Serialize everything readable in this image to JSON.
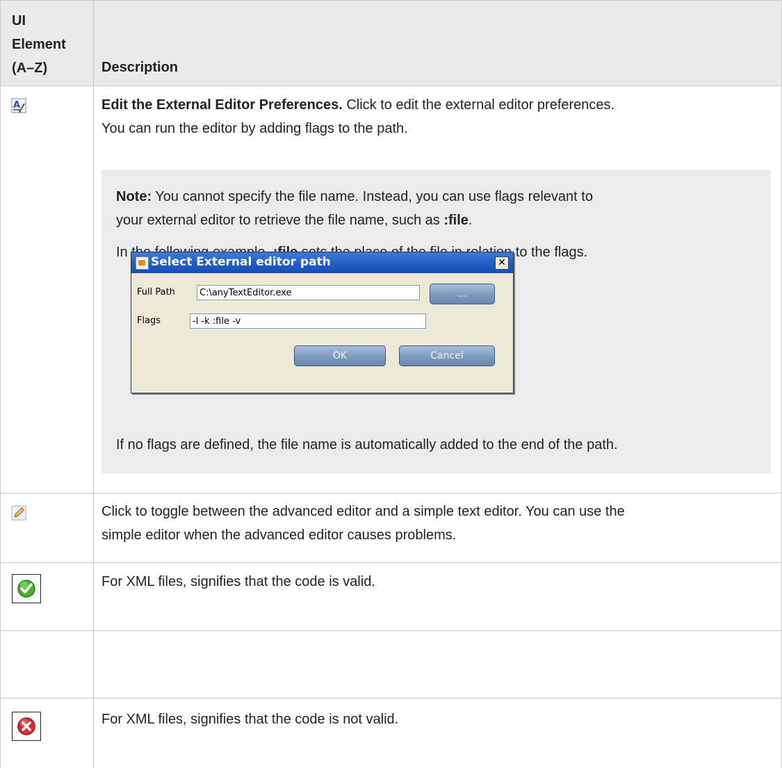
{
  "header": {
    "col1": [
      "UI",
      "Element",
      "(A–Z)"
    ],
    "col2": "Description"
  },
  "rows": [
    {
      "icon": "edit-external-editor-icon",
      "title": "Edit the External Editor Preferences.",
      "text": " Click to edit the external editor preferences.",
      "text2": "You can run the editor by adding flags to the path.",
      "note": {
        "label": "Note:",
        "line1": " You cannot specify the file name. Instead, you can use flags relevant to",
        "line2a": "your external editor to retrieve the file name, such as ",
        "line2b": ":file",
        "line2c": ".",
        "line3a": "In the following example, ",
        "line3b": ":file",
        "line3c": " sets the place of the file in relation to the flags.",
        "line4": "If no flags are defined, the file name is automatically added to the end of the path."
      },
      "dialog": {
        "title": "Select External editor path",
        "close": "✕",
        "full_path_label": "Full Path",
        "full_path_value": "C:\\anyTextEditor.exe",
        "browse_label": "...",
        "flags_label": "Flags",
        "flags_value": "-l -k :file -v",
        "ok_label": "OK",
        "cancel_label": "Cancel"
      }
    },
    {
      "icon": "pencil-icon",
      "line1": "Click to toggle between the advanced editor and a simple text editor. You can use the",
      "line2": "simple editor when the advanced editor causes problems."
    },
    {
      "icon": "valid-checkmark-icon",
      "line1": "For XML files, signifies that the code is valid."
    },
    {
      "icon": "invalid-x-icon",
      "line1": "For XML files, signifies that the code is not valid."
    }
  ]
}
